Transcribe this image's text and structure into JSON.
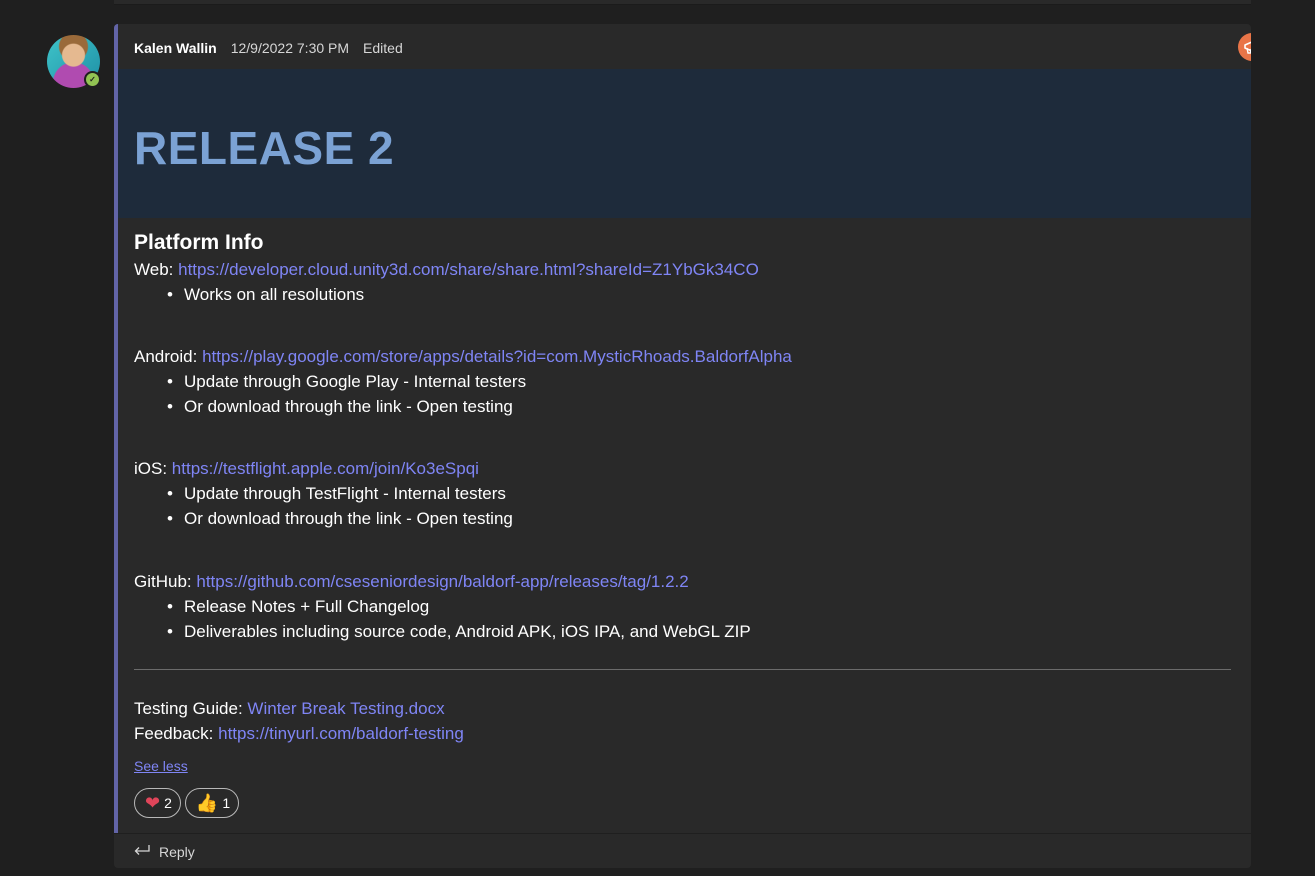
{
  "message": {
    "author": "Kalen Wallin",
    "timestamp": "12/9/2022 7:30 PM",
    "edited": "Edited",
    "icon": "announcement-megaphone-icon",
    "banner_title": "RELEASE 2"
  },
  "body": {
    "section_title": "Platform Info",
    "web": {
      "label": "Web:",
      "url": "https://developer.cloud.unity3d.com/share/share.html?shareId=Z1YbGk34CO",
      "bullets": [
        "Works on all resolutions"
      ]
    },
    "android": {
      "label": "Android:",
      "url": "https://play.google.com/store/apps/details?id=com.MysticRhoads.BaldorfAlpha",
      "bullets": [
        "Update through Google Play - Internal testers",
        "Or download through the link - Open testing"
      ]
    },
    "ios": {
      "label": "iOS:",
      "url": "https://testflight.apple.com/join/Ko3eSpqi",
      "bullets": [
        "Update through TestFlight - Internal testers",
        "Or download through the link - Open testing"
      ]
    },
    "github": {
      "label": "GitHub:",
      "url": "https://github.com/cseseniordesign/baldorf-app/releases/tag/1.2.2",
      "bullets": [
        "Release Notes + Full Changelog",
        "Deliverables including source code, Android APK, iOS IPA, and WebGL ZIP"
      ]
    },
    "testing_guide": {
      "label": "Testing Guide:",
      "link_text": "Winter Break Testing.docx"
    },
    "feedback": {
      "label": "Feedback:",
      "url": "https://tinyurl.com/baldorf-testing"
    },
    "see_less": "See less"
  },
  "reactions": [
    {
      "emoji": "❤",
      "count": "2",
      "icon": "heart-icon"
    },
    {
      "emoji": "👍",
      "count": "1",
      "icon": "thumbs-up-icon"
    }
  ],
  "reply": {
    "label": "Reply",
    "icon": "reply-arrow-icon"
  },
  "colors": {
    "accent": "#6264a7",
    "link": "#7f85f5",
    "banner_bg": "#1e2b3b",
    "banner_text": "#7ba2d4",
    "presence": "#92c353"
  }
}
